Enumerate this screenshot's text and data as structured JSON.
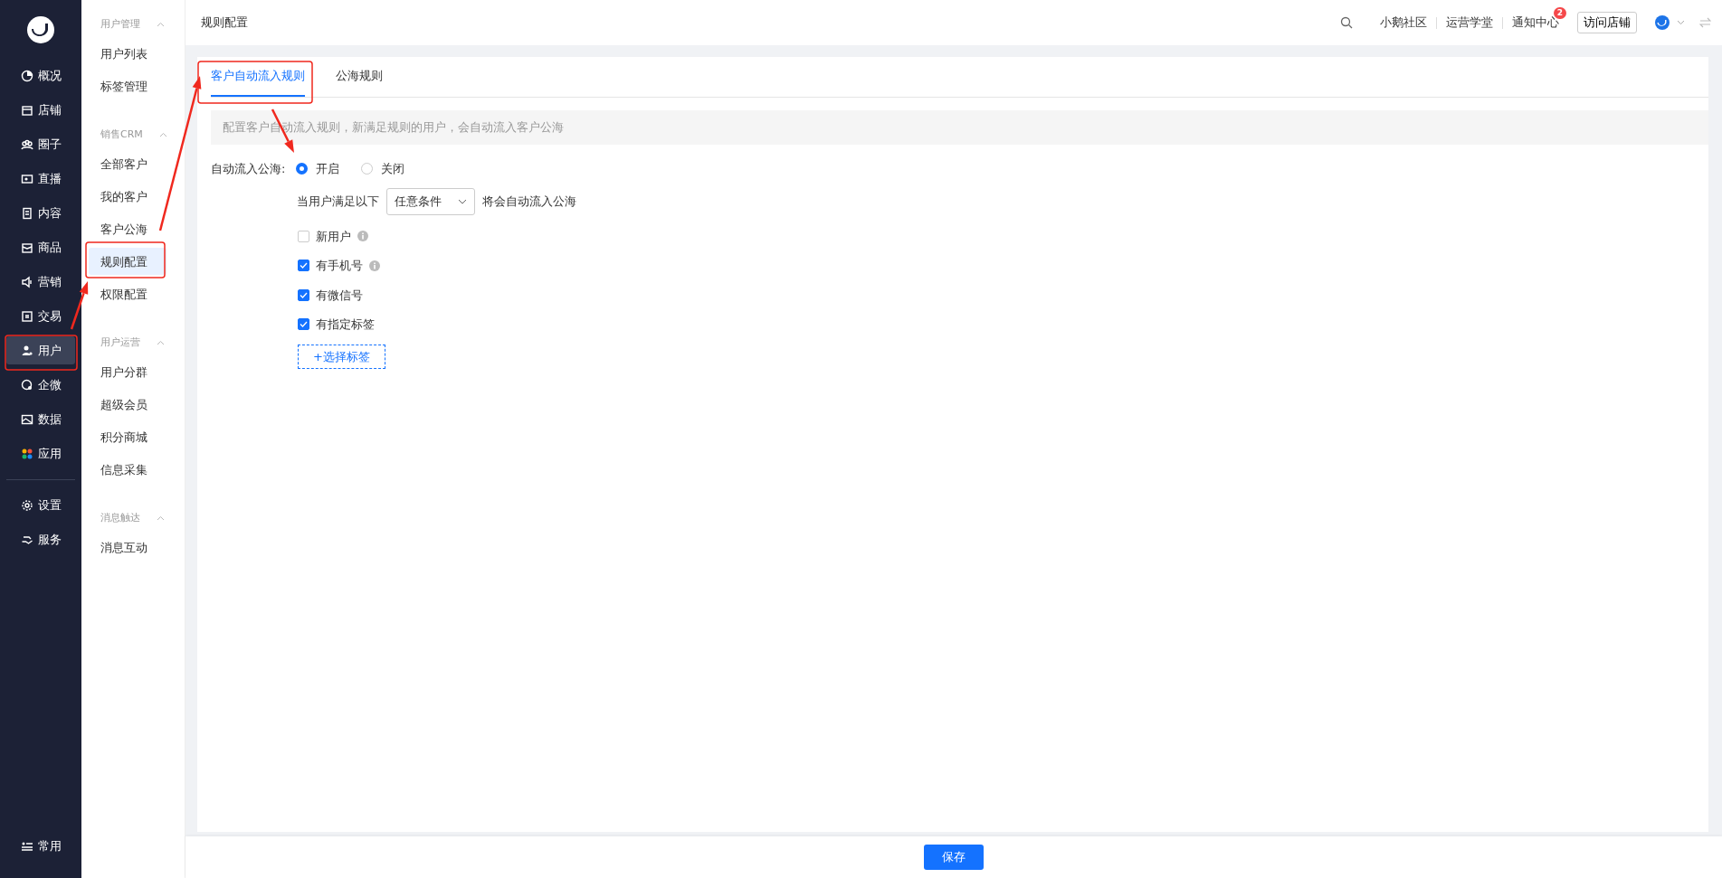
{
  "sidebar": {
    "items": [
      {
        "label": "概况",
        "selected": false
      },
      {
        "label": "店铺",
        "selected": false
      },
      {
        "label": "圈子",
        "selected": false
      },
      {
        "label": "直播",
        "selected": false
      },
      {
        "label": "内容",
        "selected": false
      },
      {
        "label": "商品",
        "selected": false
      },
      {
        "label": "营销",
        "selected": false
      },
      {
        "label": "交易",
        "selected": false
      },
      {
        "label": "用户",
        "selected": true
      },
      {
        "label": "企微",
        "selected": false
      },
      {
        "label": "数据",
        "selected": false
      },
      {
        "label": "应用",
        "selected": false
      }
    ],
    "bottom_items": [
      {
        "label": "设置",
        "selected": false
      },
      {
        "label": "服务",
        "selected": false
      }
    ],
    "footer_item": {
      "label": "常用"
    }
  },
  "subnav": {
    "groups": [
      {
        "title": "用户管理",
        "expanded": true,
        "items": [
          {
            "label": "用户列表",
            "selected": false
          },
          {
            "label": "标签管理",
            "selected": false
          }
        ]
      },
      {
        "title": "销售CRM",
        "expanded": true,
        "items": [
          {
            "label": "全部客户",
            "selected": false
          },
          {
            "label": "我的客户",
            "selected": false
          },
          {
            "label": "客户公海",
            "selected": false
          },
          {
            "label": "规则配置",
            "selected": true
          },
          {
            "label": "权限配置",
            "selected": false
          }
        ]
      },
      {
        "title": "用户运营",
        "expanded": true,
        "items": [
          {
            "label": "用户分群",
            "selected": false
          },
          {
            "label": "超级会员",
            "selected": false
          },
          {
            "label": "积分商城",
            "selected": false
          },
          {
            "label": "信息采集",
            "selected": false
          }
        ]
      },
      {
        "title": "消息触达",
        "expanded": true,
        "items": [
          {
            "label": "消息互动",
            "selected": false
          }
        ]
      }
    ]
  },
  "header": {
    "title": "规则配置",
    "links": [
      "小鹅社区",
      "运营学堂"
    ],
    "notification": {
      "label": "通知中心",
      "badge": "2"
    },
    "visit_button": "访问店铺"
  },
  "tabs": [
    {
      "label": "客户自动流入规则",
      "selected": true
    },
    {
      "label": "公海规则",
      "selected": false
    }
  ],
  "notice": "配置客户自动流入规则，新满足规则的用户，会自动流入客户公海",
  "auto_flow": {
    "label": "自动流入公海:",
    "options": [
      {
        "label": "开启",
        "selected": true
      },
      {
        "label": "关闭",
        "selected": false
      }
    ]
  },
  "condition": {
    "prefix": "当用户满足以下",
    "select_value": "任意条件",
    "suffix": "将会自动流入公海"
  },
  "checkboxes": [
    {
      "label": "新用户",
      "checked": false,
      "info": true
    },
    {
      "label": "有手机号",
      "checked": true,
      "info": true
    },
    {
      "label": "有微信号",
      "checked": true,
      "info": false
    },
    {
      "label": "有指定标签",
      "checked": true,
      "info": false
    }
  ],
  "add_tag_button": "+选择标签",
  "save_button": "保存"
}
